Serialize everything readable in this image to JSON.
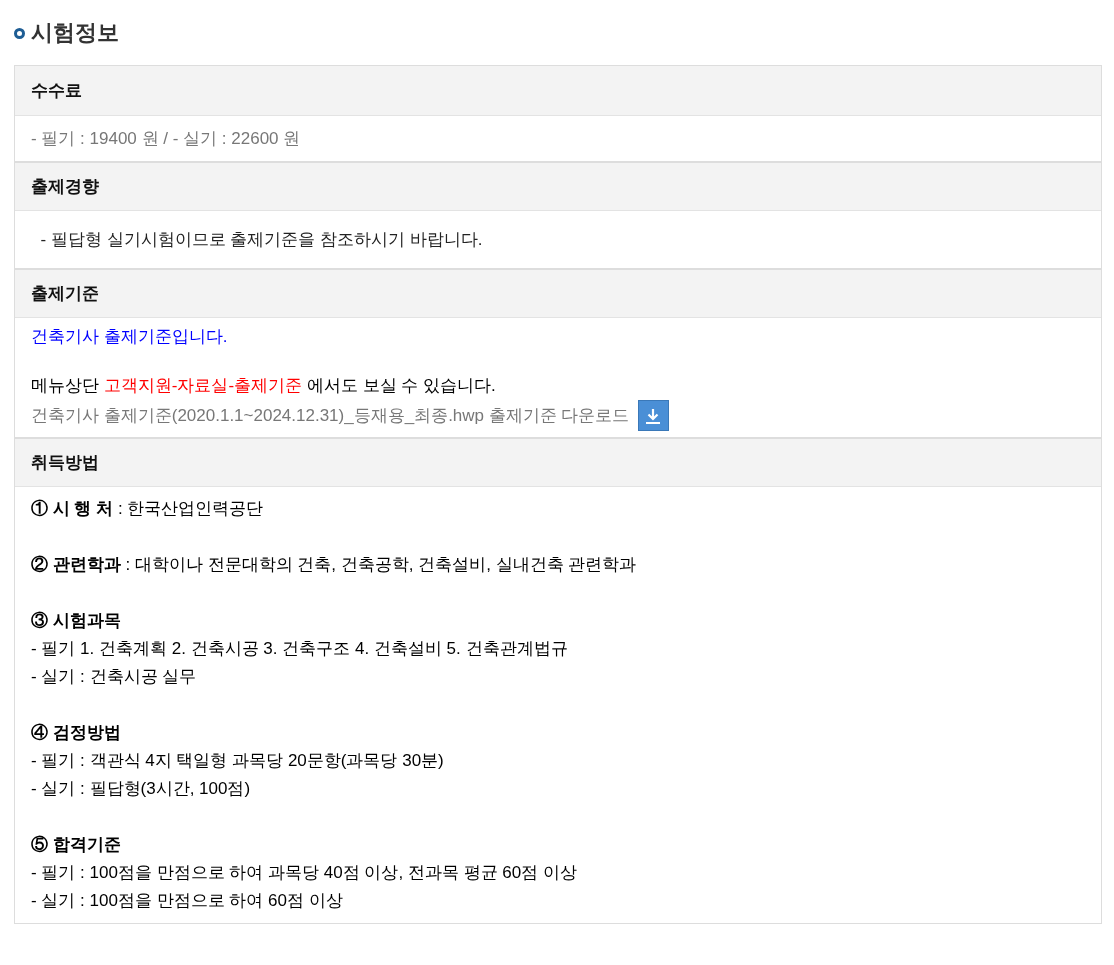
{
  "title": "시험정보",
  "sections": [
    {
      "heading": "수수료",
      "paragraphs": [
        [
          {
            "kind": "text",
            "color": "#777777",
            "text": "- 필기 : 19400 원 / - 실기 : 22600 원"
          }
        ]
      ]
    },
    {
      "heading": "출제경향",
      "paragraphs": [
        [
          {
            "kind": "text",
            "color": "#222222",
            "text": "  - 필답형 실기시험이므로 출제기준을 참조하시기 바랍니다."
          }
        ]
      ]
    },
    {
      "heading": "출제기준",
      "paragraphs": [
        [
          {
            "kind": "text",
            "color": "#0000ff",
            "text": "건축기사 출제기준입니다."
          }
        ],
        [
          {
            "kind": "parts",
            "parts": [
              {
                "text": "메뉴상단 ",
                "color": "#000000"
              },
              {
                "text": "고객지원-자료실-출제기준",
                "color": "#ff0000"
              },
              {
                "text": " 에서도 보실 수 있습니다.",
                "color": "#000000"
              }
            ]
          },
          {
            "kind": "download",
            "color": "#777777",
            "text": "건축기사 출제기준(2020.1.1~2024.12.31)_등재용_최종.hwp 출제기준 다운로드"
          }
        ]
      ]
    },
    {
      "heading": "취득방법",
      "paragraphs": [
        [
          {
            "kind": "text",
            "color": "#000000",
            "text": "**① 시 행 처** : 한국산업인력공단"
          }
        ],
        [
          {
            "kind": "text",
            "color": "#000000",
            "text": "**② 관련학과** : 대학이나 전문대학의 건축, 건축공학, 건축설비, 실내건축 관련학과"
          }
        ],
        [
          {
            "kind": "text",
            "color": "#000000",
            "text": "**③ 시험과목**"
          },
          {
            "kind": "text",
            "color": "#000000",
            "text": "- 필기 1. 건축계획 2. 건축시공 3. 건축구조 4. 건축설비 5. 건축관계법규"
          },
          {
            "kind": "text",
            "color": "#000000",
            "text": "- 실기 : 건축시공 실무"
          }
        ],
        [
          {
            "kind": "text",
            "color": "#000000",
            "text": "**④ 검정방법**"
          },
          {
            "kind": "text",
            "color": "#000000",
            "text": "- 필기 : 객관식 4지 택일형 과목당 20문항(과목당 30분)"
          },
          {
            "kind": "text",
            "color": "#000000",
            "text": "- 실기 : 필답형(3시간, 100점)"
          }
        ],
        [
          {
            "kind": "text",
            "color": "#000000",
            "text": "**⑤ 합격기준**"
          },
          {
            "kind": "text",
            "color": "#000000",
            "text": "- 필기 : 100점을 만점으로 하여 과목당 40점 이상, 전과목 평균 60점 이상"
          },
          {
            "kind": "text",
            "color": "#000000",
            "text": "- 실기 : 100점을 만점으로 하여 60점 이상"
          }
        ]
      ]
    }
  ]
}
